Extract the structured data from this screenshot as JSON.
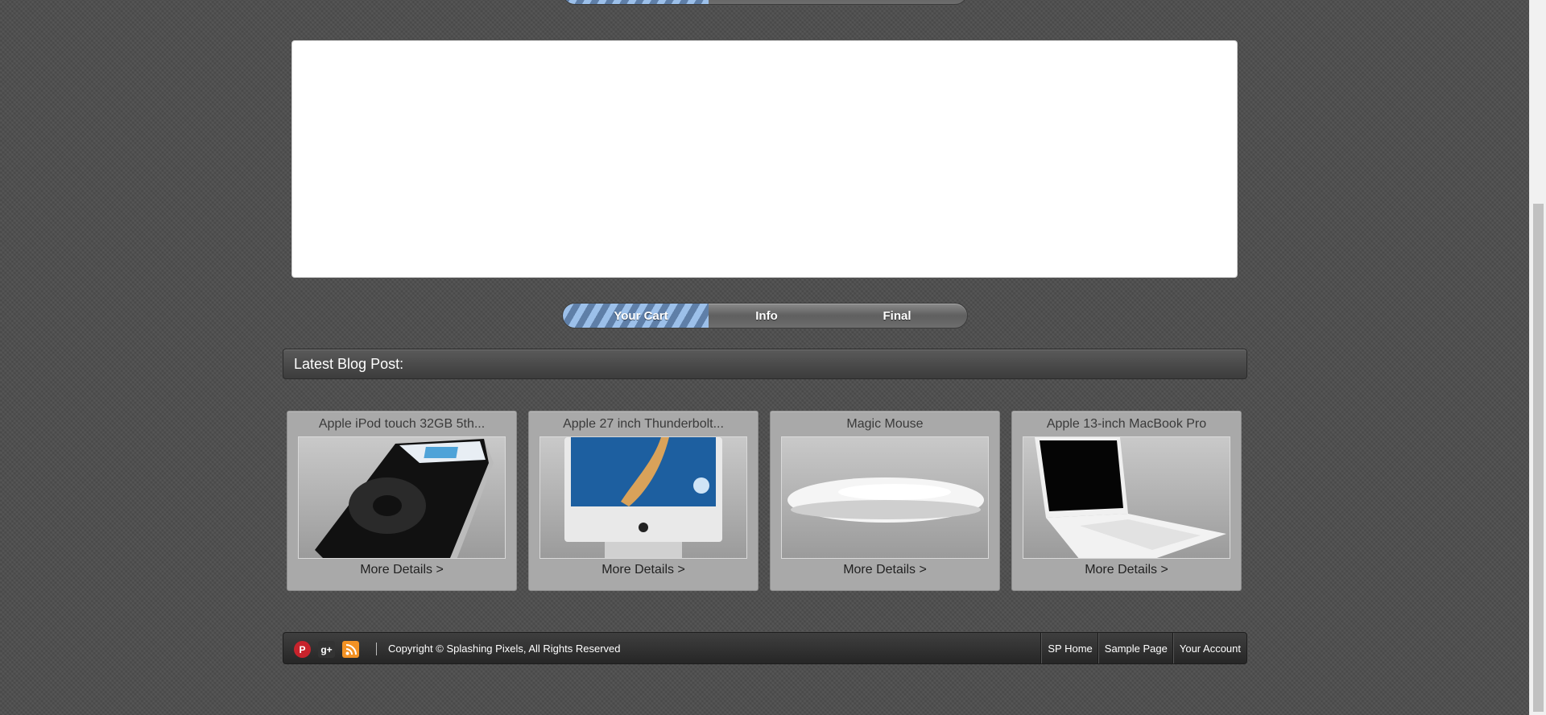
{
  "checkout_progress": {
    "steps": [
      "Your Cart",
      "Info",
      "Final"
    ],
    "active_step": "Your Cart",
    "fill_fraction": 0.36
  },
  "blog": {
    "heading": "Latest Blog Post:"
  },
  "products": [
    {
      "title": "Apple iPod touch 32GB 5th...",
      "link": "More Details >",
      "image": "ipod-image"
    },
    {
      "title": "Apple 27 inch Thunderbolt...",
      "link": "More Details >",
      "image": "imac-image"
    },
    {
      "title": "Magic Mouse",
      "link": "More Details >",
      "image": "magic-mouse-image"
    },
    {
      "title": "Apple 13-inch MacBook Pro",
      "link": "More Details >",
      "image": "macbook-image"
    }
  ],
  "footer": {
    "social_icons": [
      "pinterest-icon",
      "google-plus-icon",
      "rss-icon"
    ],
    "copyright": "Copyright © Splashing Pixels, All Rights Reserved",
    "nav": [
      "SP Home",
      "Sample Page",
      "Your Account"
    ]
  },
  "colors": {
    "page_background": "#505050",
    "progress_fill": "#9cc0ea",
    "card_background": "#a9a9a9"
  }
}
